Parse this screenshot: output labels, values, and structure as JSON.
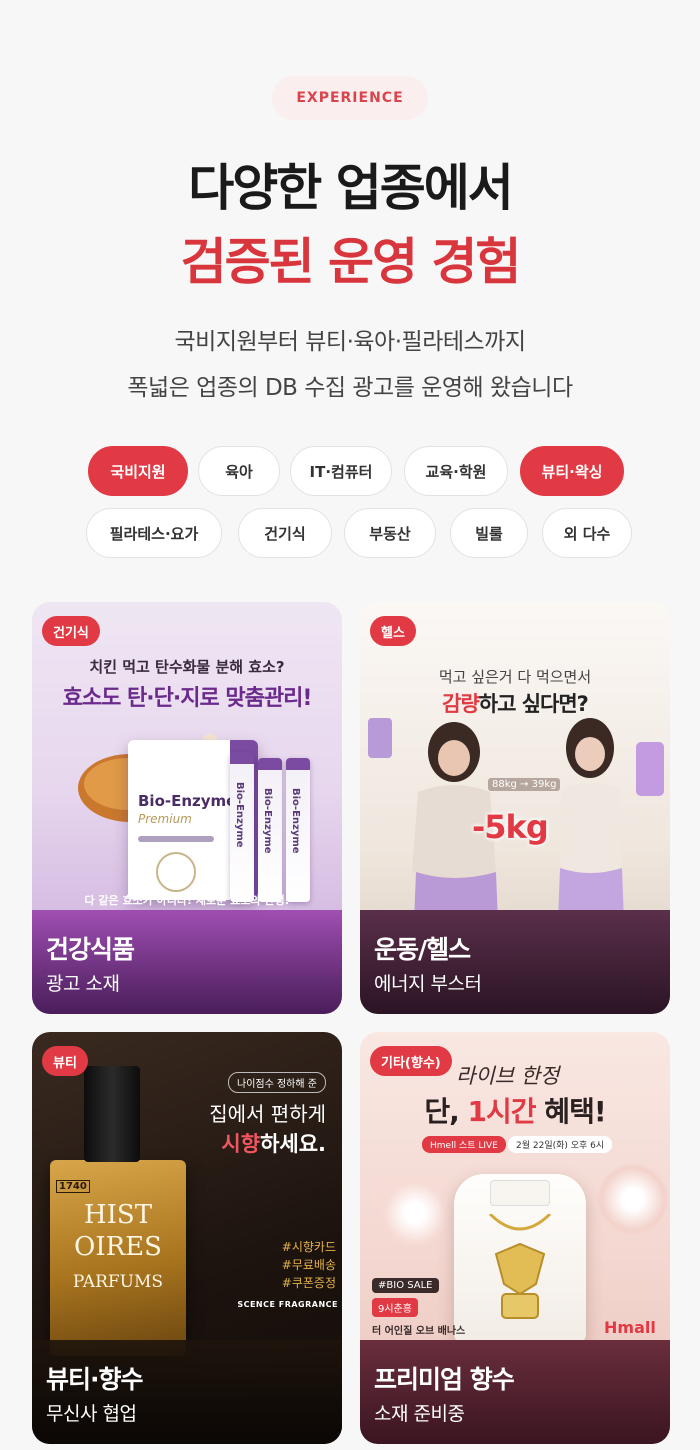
{
  "header": {
    "badge": "EXPERIENCE",
    "title_line1": "다양한 업종에서",
    "title_line2": "검증된 운영 경험",
    "sub_line1": "국비지원부터 뷰티·육아·필라테스까지",
    "sub_line2": "폭넓은 업종의 DB 수집 광고를 운영해 왔습니다"
  },
  "chips": [
    {
      "label": "국비지원",
      "active": true
    },
    {
      "label": "육아",
      "active": false
    },
    {
      "label": "IT·컴퓨터",
      "active": false
    },
    {
      "label": "교육·학원",
      "active": false
    },
    {
      "label": "뷰티·왁싱",
      "active": true
    },
    {
      "label": "필라테스·요가",
      "active": false
    },
    {
      "label": "건기식",
      "active": false
    },
    {
      "label": "부동산",
      "active": false
    },
    {
      "label": "빌룰",
      "active": false
    },
    {
      "label": "외 다수",
      "active": false
    }
  ],
  "cards": [
    {
      "tag": "건기식",
      "category": "건강식품",
      "description": "광고 소재",
      "art": {
        "line1": "치킨 먹고 탄수화물 분해 효소?",
        "line2": "효소도 탄·단·지로 맞춤관리!",
        "product": "Bio-Enzyme",
        "product_sub": "Premium",
        "stick": "Bio-Enzyme",
        "footer": "다 같은 효소가 아니다! 새로운 효소의 탄생!"
      }
    },
    {
      "tag": "헬스",
      "category": "운동/헬스",
      "description": "에너지 부스터",
      "art": {
        "line1": "먹고 싶은거 다 먹으면서",
        "line2_red": "감량",
        "line2_rest": "하고 싶다면?",
        "weights": "88kg → 39kg",
        "big": "-5kg"
      }
    },
    {
      "tag": "뷰티",
      "category": "뷰티·향수",
      "description": "무신사 협업",
      "art": {
        "top_label": "나이점수 정하해 준",
        "line1": "집에서 편하게",
        "line2_red": "시향",
        "line2_rest": "하세요.",
        "bottle_num": "1740",
        "bottle_text1": "HIST",
        "bottle_text2": "OIRES",
        "bottle_text3": "PARFUMS",
        "hashtag1": "#시향카드",
        "hashtag2": "#무료배송",
        "hashtag3": "#쿠폰증정",
        "footer": "SCENCE FRAGRANCE"
      }
    },
    {
      "tag": "기타(향수)",
      "category": "프리미엄 향수",
      "description": "소재 준비중",
      "art": {
        "line1": "라이브 한정",
        "line2_a": "단, ",
        "line2_red": "1시간",
        "line2_b": " 혜택!",
        "live_badge": "Hmell 스트 LIVE",
        "date": "2월 22일(화) 오후 6시",
        "sale": "#BIO SALE",
        "sale_sub": "9시춘흥",
        "bottom_text": "터 어인질 오브 배나스",
        "brand": "Hmall"
      }
    }
  ],
  "colors": {
    "accent": "#e13a44",
    "title_red": "#d9353d",
    "badge_bg": "#fbeeee"
  }
}
